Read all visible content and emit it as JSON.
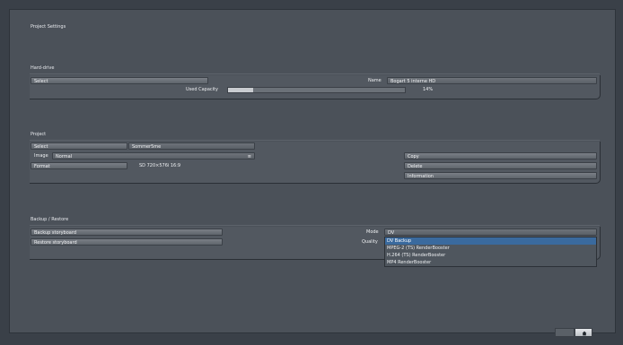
{
  "page": {
    "title": "Project Settings"
  },
  "hard_drive": {
    "section_label": "Hard-drive",
    "select_label": "Select",
    "name_label": "Name",
    "name_value": "Bogart 5 interne HD",
    "used_capacity_label": "Used Capacity",
    "used_capacity_percent_text": "14%",
    "used_capacity_fraction": 0.14
  },
  "project": {
    "section_label": "Project",
    "select_label": "Select",
    "project_name": "Sommer5me",
    "image_label": "Image",
    "image_value": "Normal",
    "format_label": "Format",
    "format_value": "SD 720×576i 16:9",
    "copy_label": "Copy",
    "delete_label": "Delete",
    "information_label": "Information"
  },
  "backup": {
    "section_label": "Backup / Restore",
    "backup_storyboard_label": "Backup storyboard",
    "restore_storyboard_label": "Restore storyboard",
    "mode_label": "Mode",
    "mode_value": "DV",
    "quality_label": "Quality",
    "options": [
      {
        "label": "DV Backup",
        "selected": true
      },
      {
        "label": "MPEG-2 (TS) RenderBooster",
        "selected": false
      },
      {
        "label": "H.264 (TS) RenderBooster",
        "selected": false
      },
      {
        "label": "MP4 RenderBooster",
        "selected": false
      }
    ]
  },
  "footer": {
    "home_icon": "home-icon"
  }
}
